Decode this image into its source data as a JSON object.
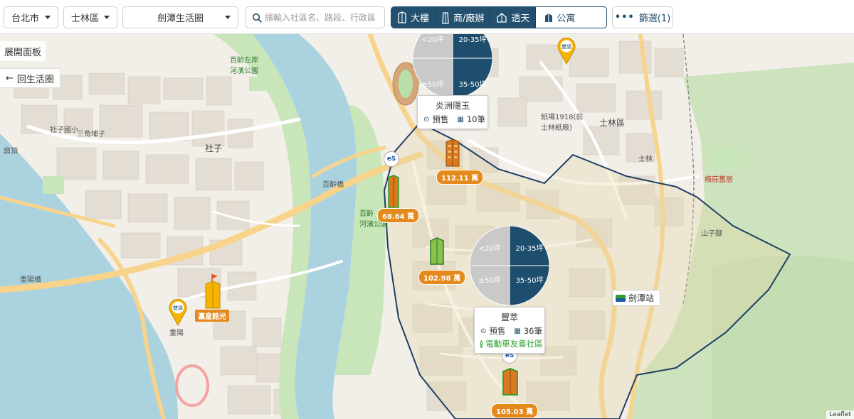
{
  "toolbar": {
    "city": "台北市",
    "district": "士林區",
    "area": "劍潭生活圈",
    "search_placeholder": "請輸入社區名、路段、行政區",
    "types": [
      {
        "label": "大樓",
        "active": true,
        "icon": "tower-icon"
      },
      {
        "label": "商/廠辦",
        "active": true,
        "icon": "office-icon"
      },
      {
        "label": "透天",
        "active": true,
        "icon": "house-icon"
      },
      {
        "label": "公寓",
        "active": false,
        "icon": "apartment-icon"
      }
    ],
    "filter_label": "篩選(1)"
  },
  "panel": {
    "expand_label": "展開面板",
    "back_label": "回生活圈"
  },
  "pies": [
    {
      "labels": [
        "<20坪",
        "20-35坪",
        "≥50坪",
        "35-50坪"
      ]
    },
    {
      "labels": [
        "<20坪",
        "20-35坪",
        "≥50坪",
        "35-50坪"
      ]
    }
  ],
  "cards": [
    {
      "title": "炎洲隱玉",
      "status": "預售",
      "count": "10筆"
    },
    {
      "title": "豐萃",
      "status": "預售",
      "count": "36筆",
      "tag": "電動車友善社區"
    }
  ],
  "prices": [
    "112.11 萬",
    "68.64 萬",
    "102.98 萬",
    "105.03 萬"
  ],
  "pin_labels": [
    "雙語",
    "雙語"
  ],
  "hotel_label": "瀛皇館光",
  "station": "劍潭站",
  "map_labels": {
    "shilin": "士林區",
    "shezi": "社子",
    "shilin_station": "士林",
    "bailing_bridge": "百齡橋",
    "bailing_park": "百齡左岸\n河濱公園",
    "bailing_park2": "百齡\n河濱公園",
    "chongyang_bridge": "重陽橋",
    "jiantan_mrt": "劍潭",
    "dingtian": "鼎頂",
    "chongyang": "重陽",
    "sanjiaopu": "三角埔子",
    "shezi_park": "社子國小",
    "paper_mill": "紙場1918(前\n士林紙廠)",
    "plum_garden": "梅莊舊居",
    "mountain": "山子腳"
  },
  "attribution": "Leaflet",
  "colors": {
    "primary": "#23506f",
    "price_tag": "#e48a1c",
    "green": "#2c9f2c",
    "river": "#aad3df",
    "boundary": "#1f3f66"
  }
}
